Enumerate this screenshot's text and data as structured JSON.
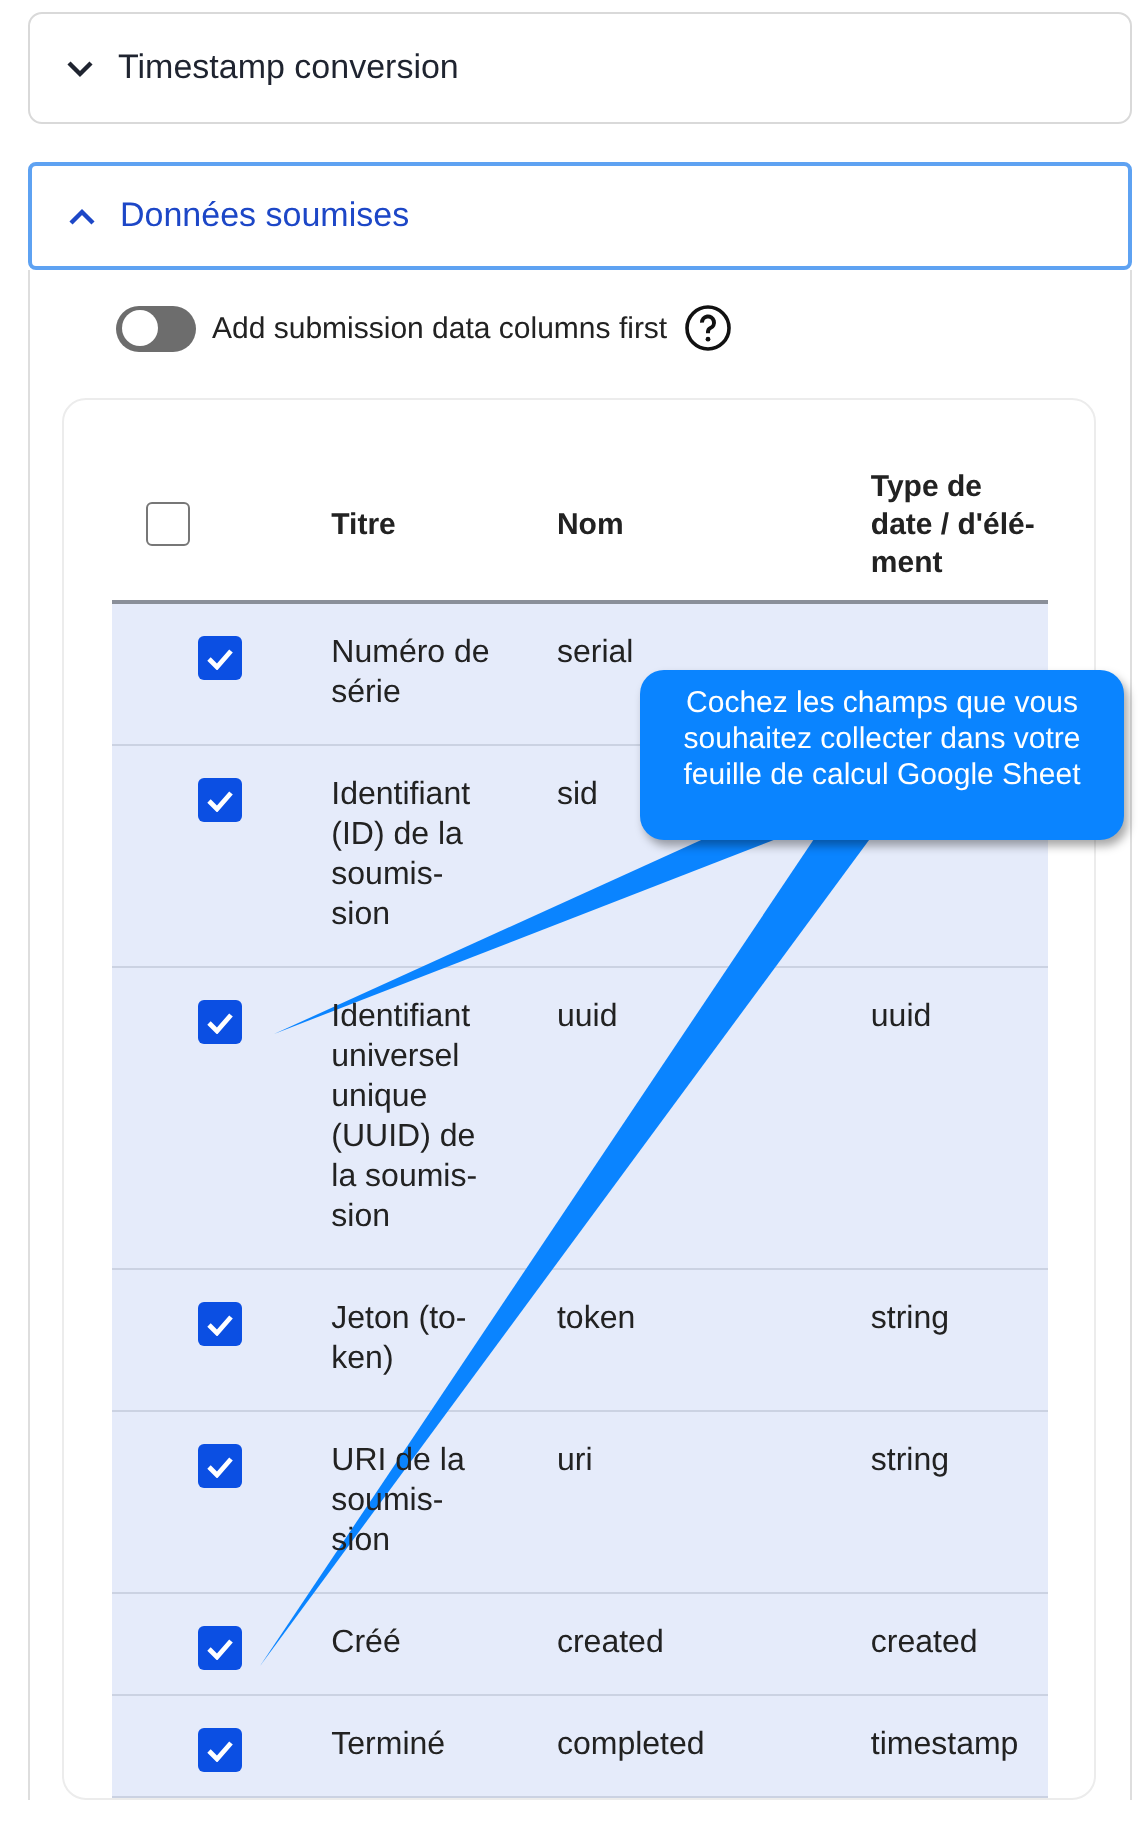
{
  "sections": [
    {
      "title": "Timestamp conversion",
      "expanded": false
    },
    {
      "title": "Données soumises",
      "expanded": true,
      "toggle": {
        "label": "Add submission data columns first",
        "on": false
      },
      "table": {
        "select_all": {
          "checked": false
        },
        "columns": [
          "Titre",
          "Nom",
          "Type de date / d'élé-ment"
        ],
        "rows": [
          {
            "title": "Numéro de série",
            "name": "serial",
            "checked": true
          },
          {
            "title": "Identifiant (ID) de la soumis-sion",
            "name": "sid",
            "checked": true
          },
          {
            "title": "Identifiant universel unique (UUID) de la soumis-sion",
            "name": "uuid",
            "type": "uuid",
            "checked": true
          },
          {
            "title": "Jeton (to-ken)",
            "name": "token",
            "type": "string",
            "checked": true
          },
          {
            "title": "URI de la soumis-sion",
            "name": "uri",
            "type": "string",
            "checked": true
          },
          {
            "title": "Créé",
            "name": "created",
            "type": "created",
            "checked": true
          },
          {
            "title": "Terminé",
            "name": "completed",
            "type": "timestamp",
            "checked": true
          }
        ]
      }
    }
  ],
  "callout": {
    "text": "Cochez les champs que vous souhaitez collecter dans votre feuille de calcul Google Sheet"
  }
}
